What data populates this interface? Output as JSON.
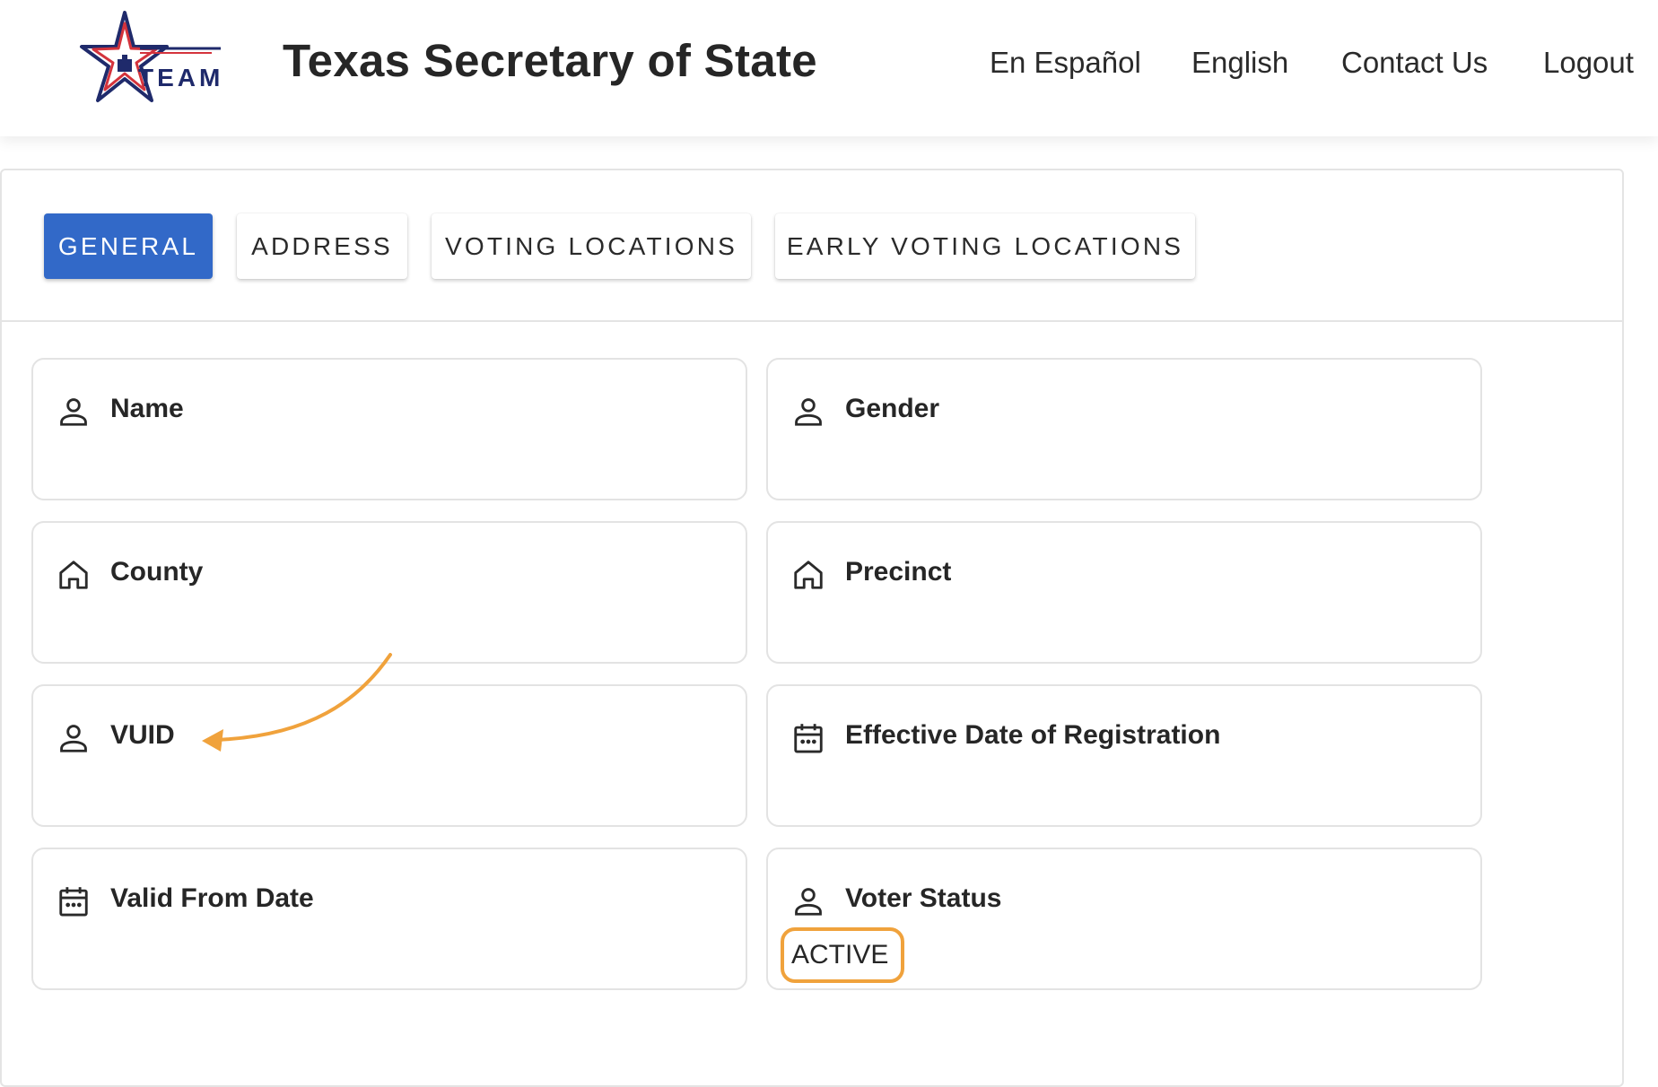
{
  "header": {
    "logo_text": "TEAM",
    "title": "Texas Secretary of State",
    "nav": [
      "En Español",
      "English",
      "Contact Us",
      "Logout"
    ]
  },
  "tabs": [
    {
      "label": "GENERAL",
      "active": true
    },
    {
      "label": "ADDRESS",
      "active": false
    },
    {
      "label": "VOTING LOCATIONS",
      "active": false
    },
    {
      "label": "EARLY VOTING LOCATIONS",
      "active": false
    }
  ],
  "fields": [
    {
      "label": "Name",
      "icon": "person-icon",
      "value": ""
    },
    {
      "label": "Gender",
      "icon": "person-icon",
      "value": ""
    },
    {
      "label": "County",
      "icon": "home-icon",
      "value": ""
    },
    {
      "label": "Precinct",
      "icon": "home-icon",
      "value": ""
    },
    {
      "label": "VUID",
      "icon": "person-icon",
      "value": ""
    },
    {
      "label": "Effective Date of Registration",
      "icon": "calendar-icon",
      "value": ""
    },
    {
      "label": "Valid From Date",
      "icon": "calendar-icon",
      "value": ""
    },
    {
      "label": "Voter Status",
      "icon": "person-icon",
      "value": "ACTIVE"
    }
  ],
  "colors": {
    "accent": "#3269c8",
    "annotation": "#f0a23c",
    "logo_blue": "#1f2a6b",
    "logo_red": "#d4333c"
  }
}
